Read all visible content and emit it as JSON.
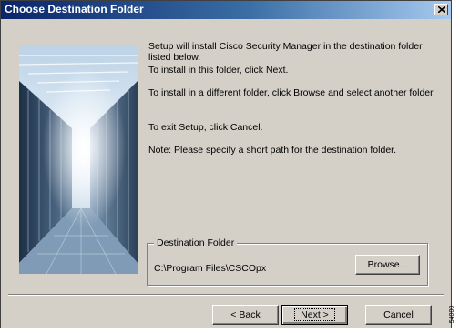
{
  "window": {
    "title": "Choose Destination Folder",
    "close_symbol": "×"
  },
  "banner": {
    "image": "server-room-image"
  },
  "instructions": {
    "line1": "Setup will install Cisco Security Manager in the destination folder listed below.",
    "line2": "To install in this folder, click Next.",
    "line3": "To install in a different folder, click Browse and select another folder.",
    "line4": "To exit Setup, click Cancel.",
    "line5": "Note: Please specify a short path for the destination folder."
  },
  "destination": {
    "group_label": "Destination Folder",
    "path": "C:\\Program Files\\CSCOpx",
    "browse_label": "Browse..."
  },
  "buttons": {
    "back": "< Back",
    "next": "Next >",
    "cancel": "Cancel"
  },
  "figure_id": "54000",
  "colors": {
    "titlebar_start": "#0a246a",
    "titlebar_end": "#a6caf0",
    "dialog_face": "#d4d0c8"
  }
}
